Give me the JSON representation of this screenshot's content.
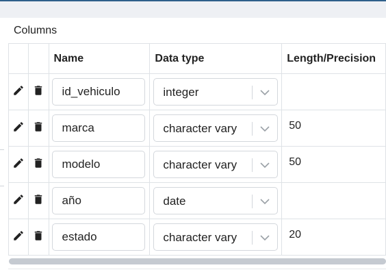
{
  "section": {
    "title": "Columns"
  },
  "table": {
    "headers": {
      "edit": "",
      "delete": "",
      "name": "Name",
      "data_type": "Data type",
      "length": "Length/Precision"
    },
    "rows": [
      {
        "name": "id_vehiculo",
        "data_type": "integer",
        "length": ""
      },
      {
        "name": "marca",
        "data_type": "character vary",
        "length": "50"
      },
      {
        "name": "modelo",
        "data_type": "character vary",
        "length": "50"
      },
      {
        "name": "año",
        "data_type": "date",
        "length": ""
      },
      {
        "name": "estado",
        "data_type": "character vary",
        "length": "20"
      }
    ]
  },
  "icons": {
    "edit": "pencil-icon",
    "delete": "trash-icon",
    "dropdown": "chevron-down-icon"
  },
  "colors": {
    "accent_top_border": "#2e5f8a",
    "grid_border": "#dee2e6",
    "input_border": "#d3d7dc",
    "scrollbar_thumb": "#c5cad1"
  }
}
